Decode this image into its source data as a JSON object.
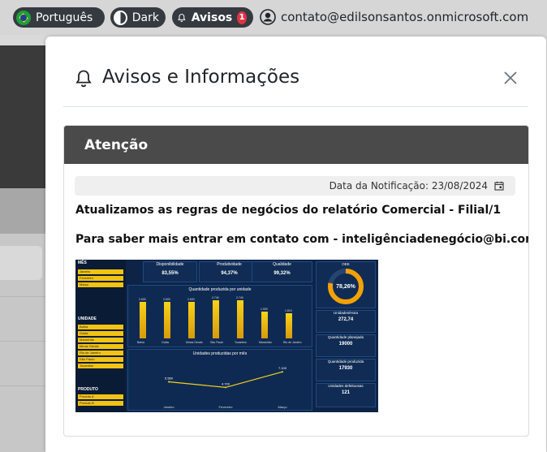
{
  "topbar": {
    "language": "Português",
    "theme": "Dark",
    "notices": "Avisos",
    "notice_count": "1",
    "account_email": "contato@edilsonsantos.onmicrosoft.com"
  },
  "modal": {
    "title": "Avisos e Informações",
    "close_icon": "close-icon",
    "card_title": "Atenção",
    "notification_date": "Data da Notificação: 23/08/2024",
    "message_1": "Atualizamos as regras de negócios do relatório Comercial - Filial/1",
    "message_2": "Para saber mais entrar em contato com - inteligênciadenegócio@bi.com"
  },
  "dashboard_image": {
    "sections": {
      "month": "MÊS",
      "unit": "UNIDADE",
      "product": "PRODUTO"
    },
    "months": [
      "Janeiro",
      "Fevereiro",
      "Março"
    ],
    "units": [
      "Bahia",
      "Goiás",
      "Maranhão",
      "Minas Gerais",
      "Rio de Janeiro",
      "São Paulo",
      "Tocantins"
    ],
    "products": [
      "Produto A",
      "Produto B"
    ],
    "kpis": [
      {
        "label": "Disponibilidade",
        "value": "83,55%"
      },
      {
        "label": "Produtividade",
        "value": "94,37%"
      },
      {
        "label": "Qualidade",
        "value": "99,32%"
      }
    ],
    "oee_label": "OEE",
    "oee_value": "78,26%",
    "bar_title": "Quantidade produzida por unidade",
    "bars": [
      {
        "label": "Bahia",
        "value": 2600
      },
      {
        "label": "Goiás",
        "value": 2600
      },
      {
        "label": "Minas Gerais",
        "value": 2600
      },
      {
        "label": "São Paulo",
        "value": 2740
      },
      {
        "label": "Tocantins",
        "value": 2740
      },
      {
        "label": "Maranhão",
        "value": 1900
      },
      {
        "label": "Rio de Janeiro",
        "value": 1810
      }
    ],
    "bar_value_labels": [
      "2.600",
      "2.600",
      "2.600",
      "2.740",
      "2.740",
      "1.900",
      "1.810"
    ],
    "line_title": "Unidades produzidas por mês",
    "line_points": [
      {
        "label": "Janeiro",
        "value": 5560,
        "text": "5.560"
      },
      {
        "label": "Fevereiro",
        "value": 4700,
        "text": "4.700"
      },
      {
        "label": "Março",
        "value": 7100,
        "text": "7.100"
      }
    ],
    "right_cards": [
      {
        "label": "Unidades/Hora",
        "value": "272,74"
      },
      {
        "label": "Quantidade planejada",
        "value": "19000"
      },
      {
        "label": "Quantidade produzida",
        "value": "17930"
      },
      {
        "label": "Unidades defeituosas",
        "value": "121"
      }
    ]
  }
}
